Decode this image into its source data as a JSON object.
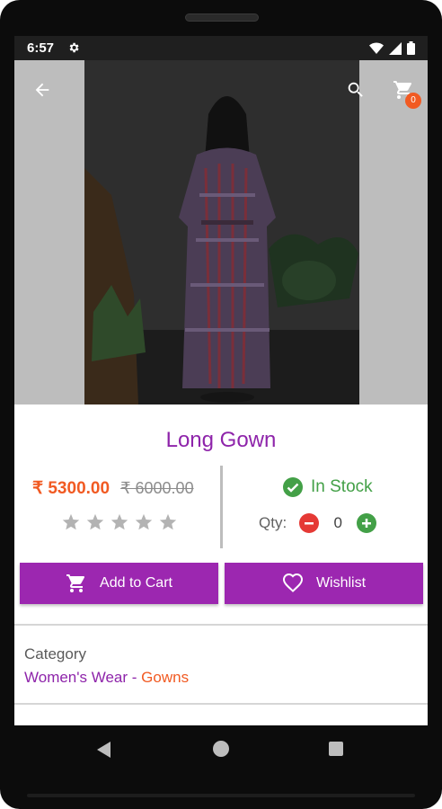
{
  "status_bar": {
    "time": "6:57"
  },
  "header": {
    "cart_count": "0"
  },
  "product": {
    "title": "Long Gown",
    "price": "₹ 5300.00",
    "old_price": "₹ 6000.00",
    "rating": 0,
    "max_rating": 5,
    "stock_status": "In Stock",
    "qty_label": "Qty:",
    "qty_value": "0"
  },
  "actions": {
    "add_to_cart": "Add to Cart",
    "wishlist": "Wishlist"
  },
  "category": {
    "label": "Category",
    "main": "Women's Wear",
    "separator": " - ",
    "sub": "Gowns"
  },
  "colors": {
    "primary": "#9c27b0",
    "title": "#8e24aa",
    "price": "#f15a22",
    "in_stock": "#43a047",
    "minus": "#e53935"
  },
  "icons": [
    "back-arrow-icon",
    "search-icon",
    "cart-icon",
    "settings-icon",
    "wifi-icon",
    "signal-icon",
    "battery-icon",
    "star-icon",
    "check-circle-icon",
    "heart-icon",
    "nav-back-icon",
    "nav-home-icon",
    "nav-recents-icon"
  ]
}
